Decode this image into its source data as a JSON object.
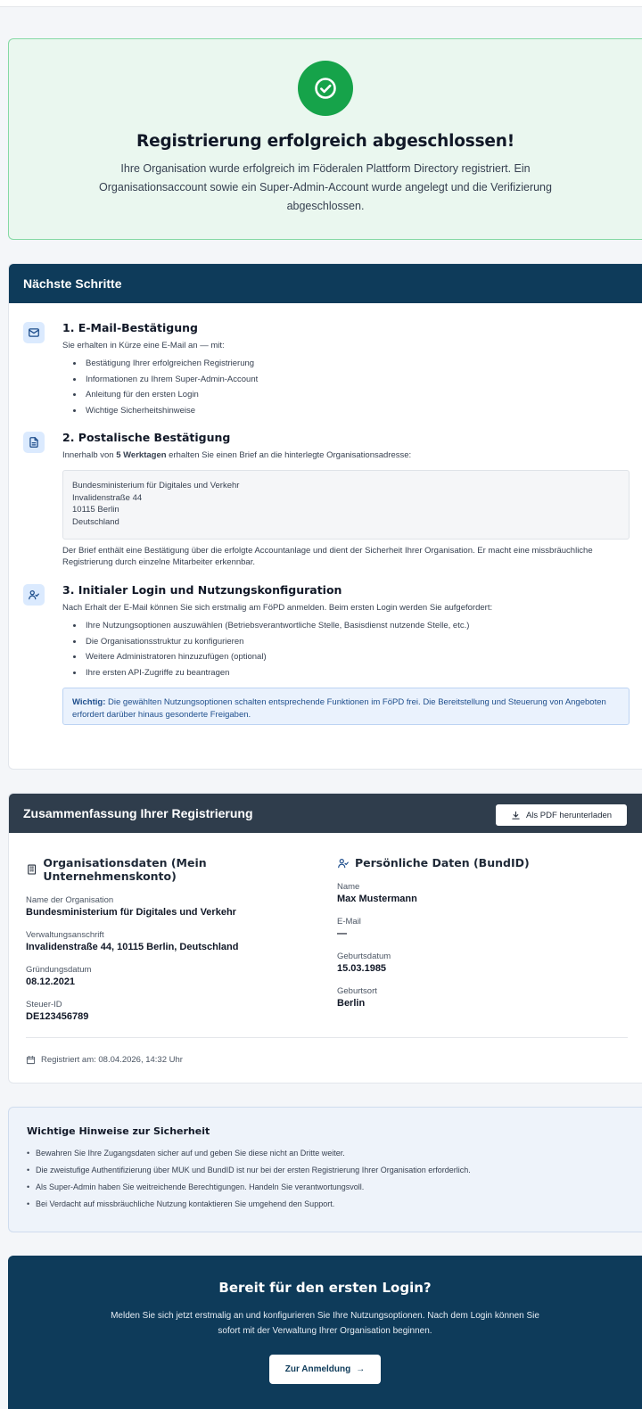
{
  "success": {
    "title": "Registrierung erfolgreich abgeschlossen!",
    "text": "Ihre Organisation wurde erfolgreich im Föderalen Plattform Directory registriert. Ein Organisationsaccount sowie ein Super-Admin-Account wurde angelegt und die Verifizierung abgeschlossen."
  },
  "next_steps": {
    "header": "Nächste Schritte",
    "step1": {
      "title": "1. E-Mail-Bestätigung",
      "text": "Sie erhalten in Kürze eine E-Mail an — mit:",
      "bullets": [
        "Bestätigung Ihrer erfolgreichen Registrierung",
        "Informationen zu Ihrem Super-Admin-Account",
        "Anleitung für den ersten Login",
        "Wichtige Sicherheitshinweise"
      ]
    },
    "step2": {
      "title": "2. Postalische Bestätigung",
      "text_pre": "Innerhalb von ",
      "text_bold": "5 Werktagen",
      "text_post": " erhalten Sie einen Brief an die hinterlegte Organisationsadresse:",
      "address": [
        "Bundesministerium für Digitales und Verkehr",
        "Invalidenstraße 44",
        "10115 Berlin",
        "Deutschland"
      ],
      "note": "Der Brief enthält eine Bestätigung über die erfolgte Accountanlage und dient der Sicherheit Ihrer Organisation. Er macht eine missbräuchliche Registrierung durch einzelne Mitarbeiter erkennbar."
    },
    "step3": {
      "title": "3. Initialer Login und Nutzungskonfiguration",
      "text": "Nach Erhalt der E-Mail können Sie sich erstmalig am FöPD anmelden. Beim ersten Login werden Sie aufgefordert:",
      "bullets": [
        "Ihre Nutzungsoptionen auszuwählen (Betriebsverantwortliche Stelle, Basisdienst nutzende Stelle, etc.)",
        "Die Organisationsstruktur zu konfigurieren",
        "Weitere Administratoren hinzuzufügen (optional)",
        "Ihre ersten API-Zugriffe zu beantragen"
      ],
      "important_label": "Wichtig:",
      "important_text": " Die gewählten Nutzungsoptionen schalten entsprechende Funktionen im FöPD frei. Die Bereitstellung und Steuerung von Angeboten erfordert darüber hinaus gesonderte Freigaben."
    }
  },
  "summary": {
    "header": "Zusammenfassung Ihrer Registrierung",
    "pdf_button": "Als PDF herunterladen",
    "org": {
      "title": "Organisationsdaten (Mein Unternehmenskonto)",
      "fields": [
        {
          "label": "Name der Organisation",
          "value": "Bundesministerium für Digitales und Verkehr"
        },
        {
          "label": "Verwaltungsanschrift",
          "value": "Invalidenstraße 44, 10115 Berlin, Deutschland"
        },
        {
          "label": "Gründungsdatum",
          "value": "08.12.2021"
        },
        {
          "label": "Steuer-ID",
          "value": "DE123456789"
        }
      ]
    },
    "personal": {
      "title": "Persönliche Daten (BundID)",
      "fields": [
        {
          "label": "Name",
          "value": "Max Mustermann"
        },
        {
          "label": "E-Mail",
          "value": "—"
        },
        {
          "label": "Geburtsdatum",
          "value": "15.03.1985"
        },
        {
          "label": "Geburtsort",
          "value": "Berlin"
        }
      ]
    },
    "registered": "Registriert am: 08.04.2026, 14:32 Uhr"
  },
  "security": {
    "title": "Wichtige Hinweise zur Sicherheit",
    "items": [
      "Bewahren Sie Ihre Zugangsdaten sicher auf und geben Sie diese nicht an Dritte weiter.",
      "Die zweistufige Authentifizierung über MUK und BundID ist nur bei der ersten Registrierung Ihrer Organisation erforderlich.",
      "Als Super-Admin haben Sie weitreichende Berechtigungen. Handeln Sie verantwortungsvoll.",
      "Bei Verdacht auf missbräuchliche Nutzung kontaktieren Sie umgehend den Support."
    ]
  },
  "cta": {
    "title": "Bereit für den ersten Login?",
    "text": "Melden Sie sich jetzt erstmalig an und konfigurieren Sie Ihre Nutzungsoptionen. Nach dem Login können Sie sofort mit der Verwaltung Ihrer Organisation beginnen.",
    "button": "Zur Anmeldung"
  },
  "colors": {
    "primary": "#0e3b5a",
    "success": "#16a34a",
    "summary_header": "#2f3d4c"
  }
}
